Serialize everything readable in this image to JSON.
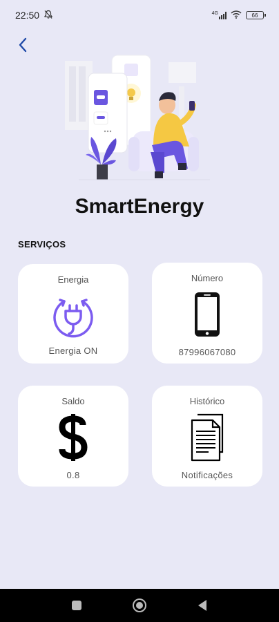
{
  "status_bar": {
    "time": "22:50",
    "network": "4G",
    "battery": "66"
  },
  "app": {
    "title": "SmartEnergy"
  },
  "section": {
    "label": "SERVIÇOS"
  },
  "cards": [
    {
      "title": "Energia",
      "value": "Energia ON",
      "icon": "power-plug-icon"
    },
    {
      "title": "Número",
      "value": "87996067080",
      "icon": "smartphone-icon"
    },
    {
      "title": "Saldo",
      "value": "0.8",
      "icon": "dollar-icon"
    },
    {
      "title": "Histórico",
      "value": "Notificações",
      "icon": "documents-icon"
    }
  ],
  "colors": {
    "background": "#e8e8f6",
    "accent": "#7c5cf0",
    "card": "#ffffff",
    "nav": "#000000"
  }
}
